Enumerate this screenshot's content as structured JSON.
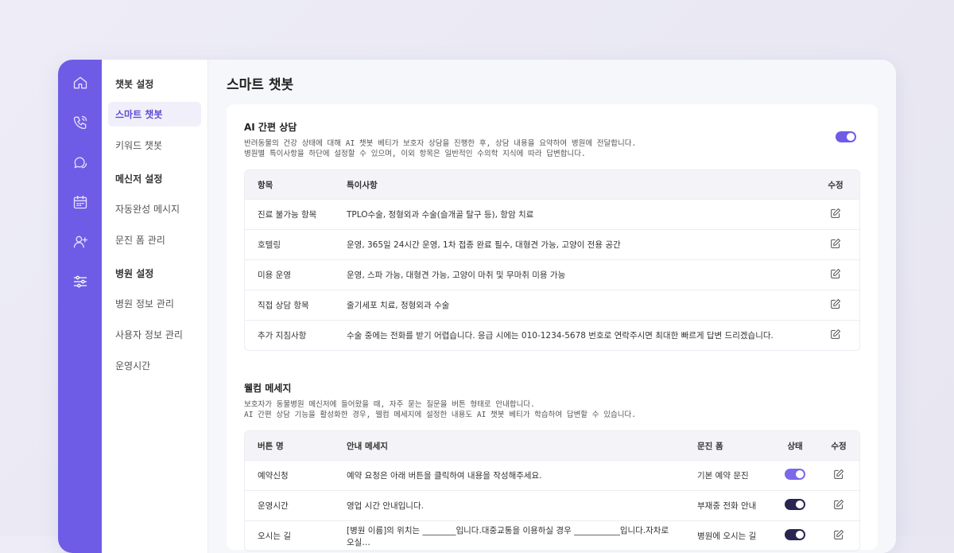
{
  "submenu": {
    "group1": "챗봇 설정",
    "items1": [
      "스마트 챗봇",
      "키워드 챗봇"
    ],
    "group2": "메신저 설정",
    "items2": [
      "자동완성 메시지",
      "문진 폼 관리"
    ],
    "group3": "병원 설정",
    "items3": [
      "병원 정보 관리",
      "사용자 정보 관리",
      "운영시간"
    ]
  },
  "rail_icons": [
    "home-icon",
    "phone-icon",
    "chat-icon",
    "calendar-icon",
    "user-plus-icon",
    "sliders-icon"
  ],
  "page_title": "스마트 챗봇",
  "ai": {
    "title": "AI 간편 상담",
    "desc1": "반려동물의 건강 상태에 대해 AI 챗봇 베티가 보호자 상담을 진행한 후, 상담 내용을 요약하여 병원에 전달합니다.",
    "desc2": "병원별 특이사항을 하단에 설정할 수 있으며, 이외 항목은 일반적인 수의학 지식에 따라 답변합니다.",
    "toggle_on": true,
    "headers": [
      "항목",
      "특이사항",
      "수정"
    ],
    "rows": [
      {
        "item": "진료 불가능 항목",
        "note": "TPLO수술, 정형외과 수술(슬개골 탈구 등), 항암 치료"
      },
      {
        "item": "호텔링",
        "note": "운영, 365일 24시간 운영, 1차 접종 완료 필수, 대형견 가능, 고양이 전용 공간"
      },
      {
        "item": "미용 운영",
        "note": "운영, 스파 가능, 대형견 가능, 고양이 마취 및 무마취 미용 가능"
      },
      {
        "item": "직접 상담 항목",
        "note": "줄기세포 치료, 정형외과 수술"
      },
      {
        "item": "추가 지침사항",
        "note": "수술 중에는 전화를 받기 어렵습니다. 응급 시에는 010-1234-5678 번호로 연락주시면 최대한 빠르게 답변 드리겠습니다."
      }
    ]
  },
  "welcome": {
    "title": "웰컴 메세지",
    "desc1": "보호자가 동물병원 메신저에 들어왔을 때, 자주 묻는 질문을 버튼 형태로 안내합니다.",
    "desc2": "AI 간편 상담 기능을 활성화한 경우, 웰컴 메세지에 설정한 내용도 AI 챗봇 베티가 학습하여 답변할 수 있습니다.",
    "headers": [
      "버튼 명",
      "안내 메세지",
      "문진 폼",
      "상태",
      "수정"
    ],
    "rows": [
      {
        "button": "예약신청",
        "message": "예약 요청은 아래 버튼을 클릭하여 내용을 작성해주세요.",
        "form": "기본 예약 문진",
        "state": "purple"
      },
      {
        "button": "운영시간",
        "message": "영업 시간 안내입니다.",
        "form": "부재중 전화 안내",
        "state": "dark"
      },
      {
        "button": "오시는 길",
        "message": "[병원 이름]의 위치는 ________입니다.대중교통을 이용하실 경우 ___________입니다.자차로 오실…",
        "form": "병원에 오시는 길",
        "state": "dark"
      }
    ]
  }
}
